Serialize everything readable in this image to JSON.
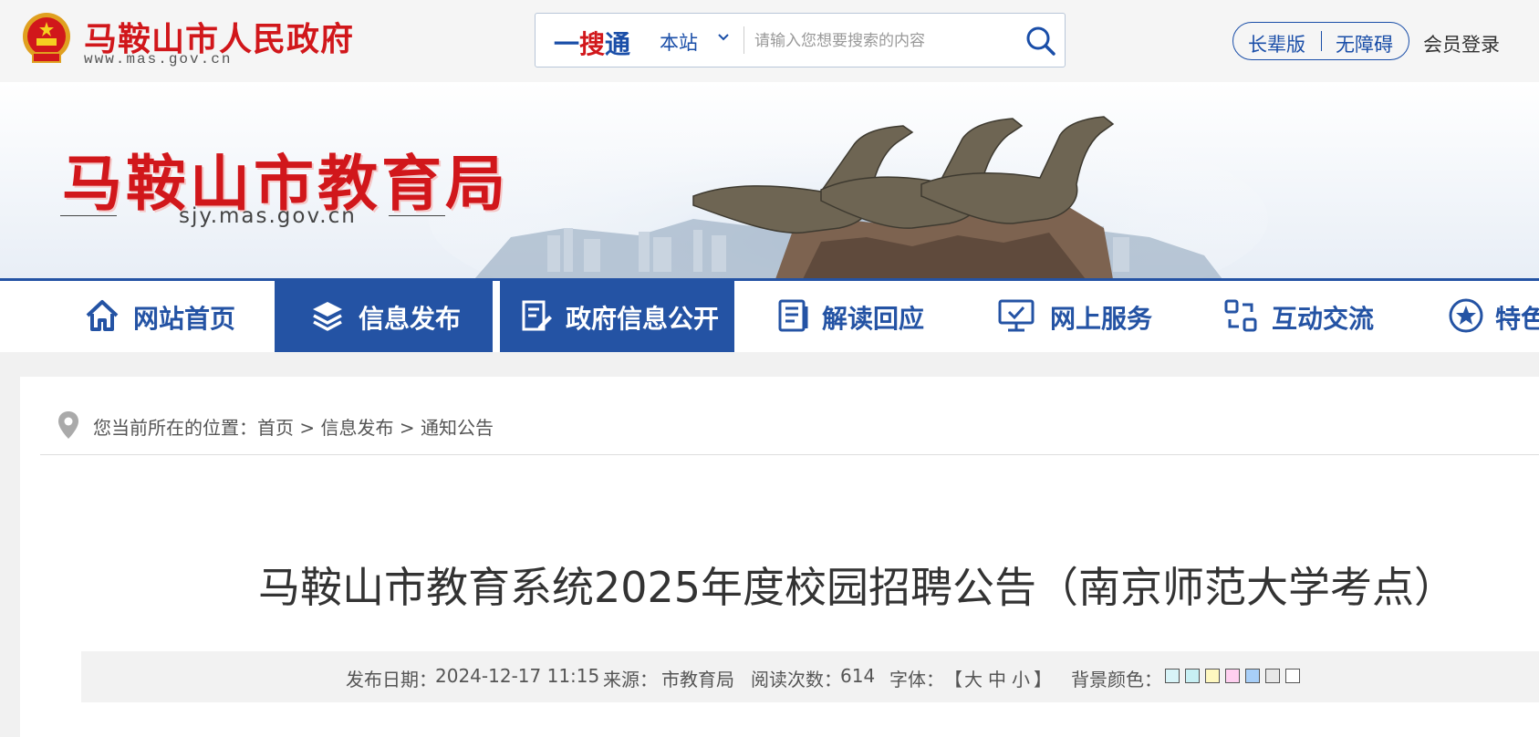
{
  "header": {
    "gov_name": "马鞍山市人民政府",
    "gov_url": "www.mas.gov.cn",
    "search": {
      "brand_1": "一",
      "brand_2": "搜",
      "brand_3": "通",
      "scope": "本站",
      "placeholder": "请输入您想要搜索的内容"
    },
    "elder_mode": "长辈版",
    "accessibility": "无障碍",
    "login": "会员登录"
  },
  "banner": {
    "title": "马鞍山市教育局",
    "subtitle": "sjy.mas.gov.cn"
  },
  "nav": {
    "items": [
      {
        "label": "网站首页",
        "icon": "home-icon"
      },
      {
        "label": "信息发布",
        "icon": "layers-icon"
      },
      {
        "label": "政府信息公开",
        "icon": "document-edit-icon"
      },
      {
        "label": "解读回应",
        "icon": "book-icon"
      },
      {
        "label": "网上服务",
        "icon": "monitor-check-icon"
      },
      {
        "label": "互动交流",
        "icon": "exchange-icon"
      },
      {
        "label": "特色",
        "icon": "star-icon"
      }
    ]
  },
  "breadcrumb": {
    "prefix": "您当前所在的位置：",
    "home": "首页",
    "sep": ">",
    "level1": "信息发布",
    "level2": "通知公告"
  },
  "article": {
    "title": "马鞍山市教育系统2025年度校园招聘公告（南京师范大学考点）",
    "date_label": "发布日期：",
    "date": "2024-12-17 11:15",
    "source_label": "来源：",
    "source": "市教育局",
    "views_label": "阅读次数：",
    "views": "614",
    "font_label": "字体：",
    "font_open": "【",
    "font_large": "大",
    "font_medium": "中",
    "font_small": "小",
    "font_close": "】",
    "bg_label": "背景颜色：",
    "bg_colors": [
      "#d8f4f8",
      "#c8f0f4",
      "#fff8c0",
      "#ffd0f0",
      "#a8cff8",
      "#e8e8e8",
      "#ffffff"
    ]
  },
  "colors": {
    "brand_red": "#d1171b",
    "brand_blue": "#2453a4"
  }
}
